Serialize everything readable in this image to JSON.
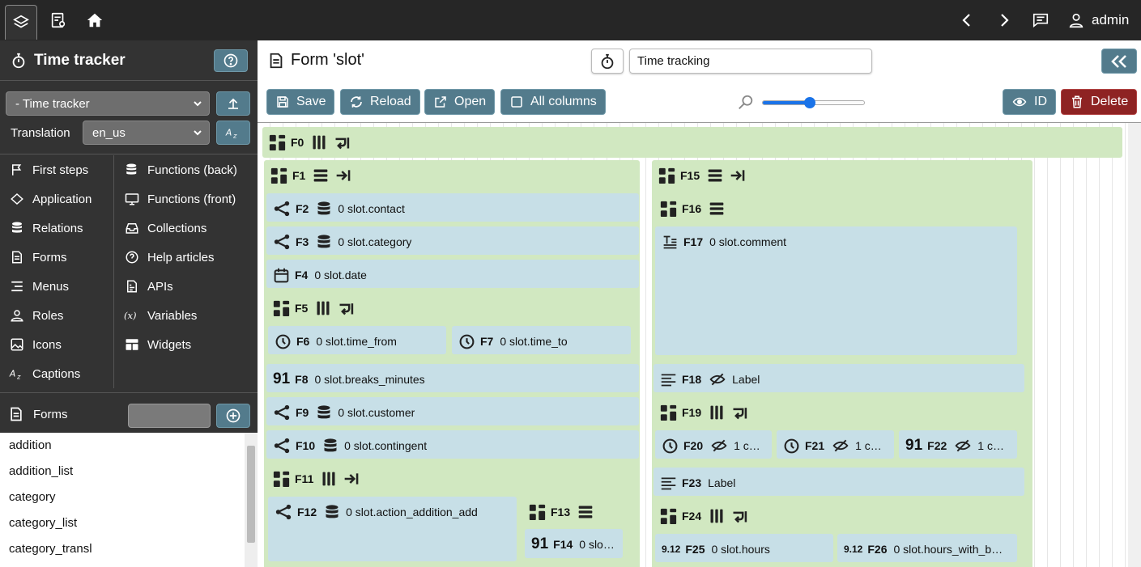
{
  "topbar": {
    "user": "admin"
  },
  "sidebar": {
    "title": "Time tracker",
    "module_select": "- Time tracker",
    "translation_label": "Translation",
    "translation_select": "en_us",
    "nav_left": [
      {
        "label": "First steps",
        "icon": "flag-icon"
      },
      {
        "label": "Application",
        "icon": "diamond-icon"
      },
      {
        "label": "Relations",
        "icon": "database-icon"
      },
      {
        "label": "Forms",
        "icon": "form-icon"
      },
      {
        "label": "Menus",
        "icon": "menu-icon"
      },
      {
        "label": "Roles",
        "icon": "roles-icon"
      },
      {
        "label": "Icons",
        "icon": "image-icon"
      },
      {
        "label": "Captions",
        "icon": "caption-icon"
      }
    ],
    "nav_right": [
      {
        "label": "Functions (back)",
        "icon": "database-function-icon"
      },
      {
        "label": "Functions (front)",
        "icon": "monitor-function-icon"
      },
      {
        "label": "Collections",
        "icon": "inbox-icon"
      },
      {
        "label": "Help articles",
        "icon": "help-icon"
      },
      {
        "label": "APIs",
        "icon": "api-icon"
      },
      {
        "label": "Variables",
        "icon": "variable-icon"
      },
      {
        "label": "Widgets",
        "icon": "widgets-icon"
      }
    ],
    "forms_label": "Forms",
    "forms_list": [
      "addition",
      "addition_list",
      "category",
      "category_list",
      "category_transl"
    ]
  },
  "main": {
    "title": "Form 'slot'",
    "form_name": "Time tracking",
    "toolbar": {
      "save": "Save",
      "reload": "Reload",
      "open": "Open",
      "all_columns": "All columns",
      "id": "ID",
      "delete": "Delete"
    },
    "zoom_level": 0.46
  },
  "fields": {
    "F0": {
      "id": "F0"
    },
    "F1": {
      "id": "F1"
    },
    "F2": {
      "id": "F2",
      "text": "0 slot.contact"
    },
    "F3": {
      "id": "F3",
      "text": "0 slot.category"
    },
    "F4": {
      "id": "F4",
      "text": "0 slot.date"
    },
    "F5": {
      "id": "F5"
    },
    "F6": {
      "id": "F6",
      "text": "0 slot.time_from"
    },
    "F7": {
      "id": "F7",
      "text": "0 slot.time_to"
    },
    "F8": {
      "id": "F8",
      "text": "0 slot.breaks_minutes",
      "badge": "91"
    },
    "F9": {
      "id": "F9",
      "text": "0 slot.customer"
    },
    "F10": {
      "id": "F10",
      "text": "0 slot.contingent"
    },
    "F11": {
      "id": "F11"
    },
    "F12": {
      "id": "F12",
      "text": "0 slot.action_addition_add"
    },
    "F13": {
      "id": "F13"
    },
    "F14": {
      "id": "F14",
      "text": "0 slo…",
      "badge": "91"
    },
    "F15": {
      "id": "F15"
    },
    "F16": {
      "id": "F16"
    },
    "F17": {
      "id": "F17",
      "text": "0 slot.comment"
    },
    "F18": {
      "id": "F18",
      "text": "Label"
    },
    "F19": {
      "id": "F19"
    },
    "F20": {
      "id": "F20",
      "text": "1 c…"
    },
    "F21": {
      "id": "F21",
      "text": "1 c…"
    },
    "F22": {
      "id": "F22",
      "text": "1 c…",
      "badge": "91"
    },
    "F23": {
      "id": "F23",
      "text": "Label"
    },
    "F24": {
      "id": "F24"
    },
    "F25": {
      "id": "F25",
      "text": "0 slot.hours",
      "badge": "9.12"
    },
    "F26": {
      "id": "F26",
      "text": "0 slot.hours_with_b…",
      "badge": "9.12"
    }
  }
}
